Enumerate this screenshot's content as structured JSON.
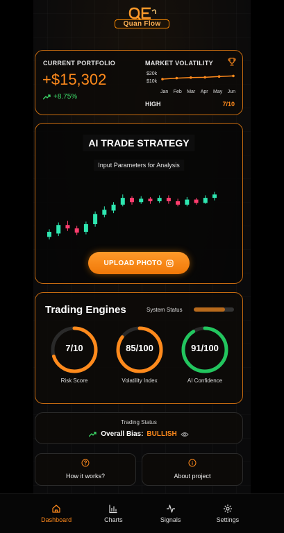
{
  "app": {
    "brand": "Quan Flow"
  },
  "portfolio": {
    "label": "CURRENT PORTFOLIO",
    "value": "+$15,302",
    "change": "+8.75%"
  },
  "volatility": {
    "label": "MARKET VOLATILITY",
    "y_labels": [
      "$20k",
      "$10k"
    ],
    "months": [
      "Jan",
      "Feb",
      "Mar",
      "Apr",
      "May",
      "Jun"
    ],
    "values": [
      0.55,
      0.62,
      0.66,
      0.68,
      0.74,
      0.78
    ],
    "high_label": "HIGH",
    "score": "7/10"
  },
  "strategy": {
    "title": "AI TRADE STRATEGY",
    "subtitle": "Input Parameters for Analysis",
    "upload_label": "UPLOAD PHOTO",
    "candles": [
      {
        "o": 0.3,
        "c": 0.36,
        "h": 0.39,
        "l": 0.27
      },
      {
        "o": 0.34,
        "c": 0.44,
        "h": 0.47,
        "l": 0.31
      },
      {
        "o": 0.44,
        "c": 0.4,
        "h": 0.49,
        "l": 0.37
      },
      {
        "o": 0.4,
        "c": 0.35,
        "h": 0.43,
        "l": 0.32
      },
      {
        "o": 0.36,
        "c": 0.45,
        "h": 0.48,
        "l": 0.33
      },
      {
        "o": 0.45,
        "c": 0.57,
        "h": 0.6,
        "l": 0.42
      },
      {
        "o": 0.56,
        "c": 0.62,
        "h": 0.66,
        "l": 0.53
      },
      {
        "o": 0.61,
        "c": 0.68,
        "h": 0.71,
        "l": 0.58
      },
      {
        "o": 0.68,
        "c": 0.76,
        "h": 0.8,
        "l": 0.66
      },
      {
        "o": 0.76,
        "c": 0.71,
        "h": 0.78,
        "l": 0.68
      },
      {
        "o": 0.71,
        "c": 0.75,
        "h": 0.78,
        "l": 0.69
      },
      {
        "o": 0.75,
        "c": 0.72,
        "h": 0.77,
        "l": 0.69
      },
      {
        "o": 0.72,
        "c": 0.76,
        "h": 0.79,
        "l": 0.7
      },
      {
        "o": 0.76,
        "c": 0.72,
        "h": 0.79,
        "l": 0.69
      },
      {
        "o": 0.72,
        "c": 0.68,
        "h": 0.75,
        "l": 0.66
      },
      {
        "o": 0.68,
        "c": 0.74,
        "h": 0.77,
        "l": 0.66
      },
      {
        "o": 0.74,
        "c": 0.7,
        "h": 0.76,
        "l": 0.68
      },
      {
        "o": 0.7,
        "c": 0.76,
        "h": 0.79,
        "l": 0.69
      },
      {
        "o": 0.76,
        "c": 0.8,
        "h": 0.83,
        "l": 0.73
      }
    ]
  },
  "engines": {
    "title": "Trading Engines",
    "system_status_label": "System Status",
    "system_status_level": 0.78,
    "gauges": [
      {
        "value": "7/10",
        "label": "Risk Score",
        "fraction": 0.7,
        "color": "#ff8a1c"
      },
      {
        "value": "85/100",
        "label": "Volatility Index",
        "fraction": 0.85,
        "color": "#ff8a1c"
      },
      {
        "value": "91/100",
        "label": "AI Confidence",
        "fraction": 0.91,
        "color": "#22c55e"
      }
    ]
  },
  "status": {
    "label": "Trading Status",
    "bias_label": "Overall Bias:",
    "bias_value": "BULLISH"
  },
  "info": {
    "how_label": "How it works?",
    "about_label": "About project"
  },
  "nav": {
    "items": [
      {
        "label": "Dashboard",
        "icon": "home-icon",
        "active": true
      },
      {
        "label": "Charts",
        "icon": "bar-chart-icon",
        "active": false
      },
      {
        "label": "Signals",
        "icon": "pulse-icon",
        "active": false
      },
      {
        "label": "Settings",
        "icon": "gear-icon",
        "active": false
      }
    ]
  },
  "colors": {
    "accent": "#ff8a1c",
    "bull": "#2ee6b0",
    "bear": "#ff3d6e",
    "success": "#22c55e"
  }
}
